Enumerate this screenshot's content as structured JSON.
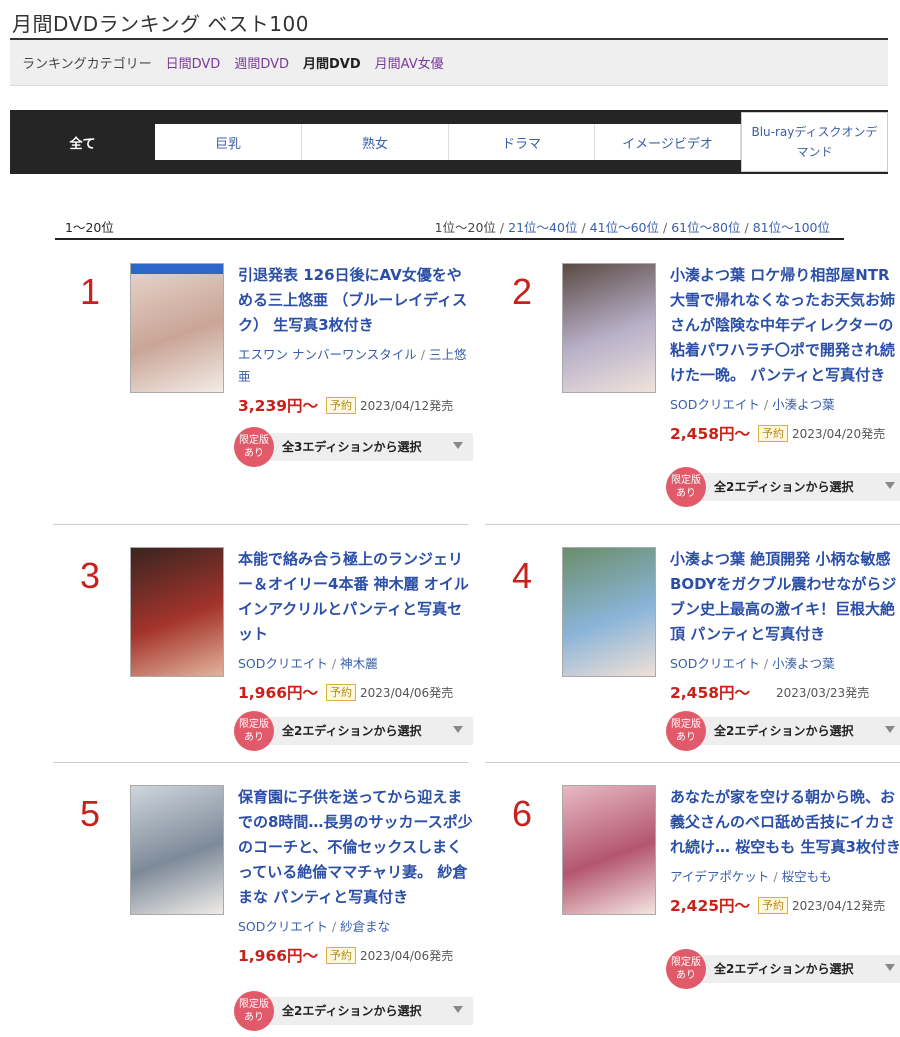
{
  "page": {
    "title": "月間DVDランキング ベスト100"
  },
  "category_bar": {
    "label": "ランキングカテゴリー",
    "items": [
      {
        "label": "日間DVD",
        "active": false
      },
      {
        "label": "週間DVD",
        "active": false
      },
      {
        "label": "月間DVD",
        "active": true
      },
      {
        "label": "月間AV女優",
        "active": false
      }
    ]
  },
  "genre_tabs": {
    "all": "全て",
    "items": [
      "巨乳",
      "熟女",
      "ドラマ",
      "イメージビデオ"
    ],
    "last": "Blu-rayディスクオンデマンド"
  },
  "range": {
    "current": "1〜20位",
    "nav": [
      {
        "label": "1位〜20位",
        "current": true
      },
      {
        "label": "21位〜40位",
        "current": false
      },
      {
        "label": "41位〜60位",
        "current": false
      },
      {
        "label": "61位〜80位",
        "current": false
      },
      {
        "label": "81位〜100位",
        "current": false
      }
    ]
  },
  "items": [
    {
      "rank": "1",
      "title": "引退発表 126日後にAV女優をやめる三上悠亜 （ブルーレイディスク） 生写真3枚付き",
      "maker": "エスワン ナンバーワンスタイル",
      "actress": "三上悠亜",
      "price": "3,239円〜",
      "badge": "予約",
      "date": "2023/04/12発売",
      "edition_badge": "限定版あり",
      "edition": "全3エディションから選択",
      "colors": [
        "#e8d6cc",
        "#c9a597",
        "#f3ece6"
      ]
    },
    {
      "rank": "2",
      "title": "小湊よつ葉 ロケ帰り相部屋NTR 大雪で帰れなくなったお天気お姉さんが陰険な中年ディレクターの粘着パワハラチ〇ポで開発され続けた一晩。 パンティと写真付き",
      "maker": "SODクリエイト",
      "actress": "小湊よつ葉",
      "price": "2,458円〜",
      "badge": "予約",
      "date": "2023/04/20発売",
      "edition_badge": "限定版あり",
      "edition": "全2エディションから選択",
      "colors": [
        "#5a4a44",
        "#b8b0c8",
        "#efe3dc"
      ]
    },
    {
      "rank": "3",
      "title": "本能で絡み合う極上のランジェリー＆オイリー4本番 神木麗 オイルインアクリルとパンティと写真セット",
      "maker": "SODクリエイト",
      "actress": "神木麗",
      "price": "1,966円〜",
      "badge": "予約",
      "date": "2023/04/06発売",
      "edition_badge": "限定版あり",
      "edition": "全2エディションから選択",
      "colors": [
        "#3a2420",
        "#a4342c",
        "#e2b49c"
      ]
    },
    {
      "rank": "4",
      "title": "小湊よつ葉 絶頂開発 小柄な敏感BODYをガクブル震わせながらジブン史上最高の激イキ！巨根大絶頂 パンティと写真付き",
      "maker": "SODクリエイト",
      "actress": "小湊よつ葉",
      "price": "2,458円〜",
      "badge": "",
      "date": "2023/03/23発売",
      "edition_badge": "限定版あり",
      "edition": "全2エディションから選択",
      "colors": [
        "#6b8e6a",
        "#8ab4d8",
        "#f1e0d6"
      ]
    },
    {
      "rank": "5",
      "title": "保育園に子供を送ってから迎えまでの8時間…長男のサッカースポ少のコーチと、不倫セックスしまくっている絶倫ママチャリ妻。 紗倉まな パンティと写真付き",
      "maker": "SODクリエイト",
      "actress": "紗倉まな",
      "price": "1,966円〜",
      "badge": "予約",
      "date": "2023/04/06発売",
      "edition_badge": "限定版あり",
      "edition": "全2エディションから選択",
      "colors": [
        "#cfd6dc",
        "#7d8a99",
        "#f0ece8"
      ]
    },
    {
      "rank": "6",
      "title": "あなたが家を空ける朝から晩、お義父さんのベロ舐め舌技にイカされ続け… 桜空もも 生写真3枚付き",
      "maker": "アイデアポケット",
      "actress": "桜空もも",
      "price": "2,425円〜",
      "badge": "予約",
      "date": "2023/04/12発売",
      "edition_badge": "限定版あり",
      "edition": "全2エディションから選択",
      "colors": [
        "#e7b9c4",
        "#b3566f",
        "#f4e6e2"
      ]
    }
  ]
}
